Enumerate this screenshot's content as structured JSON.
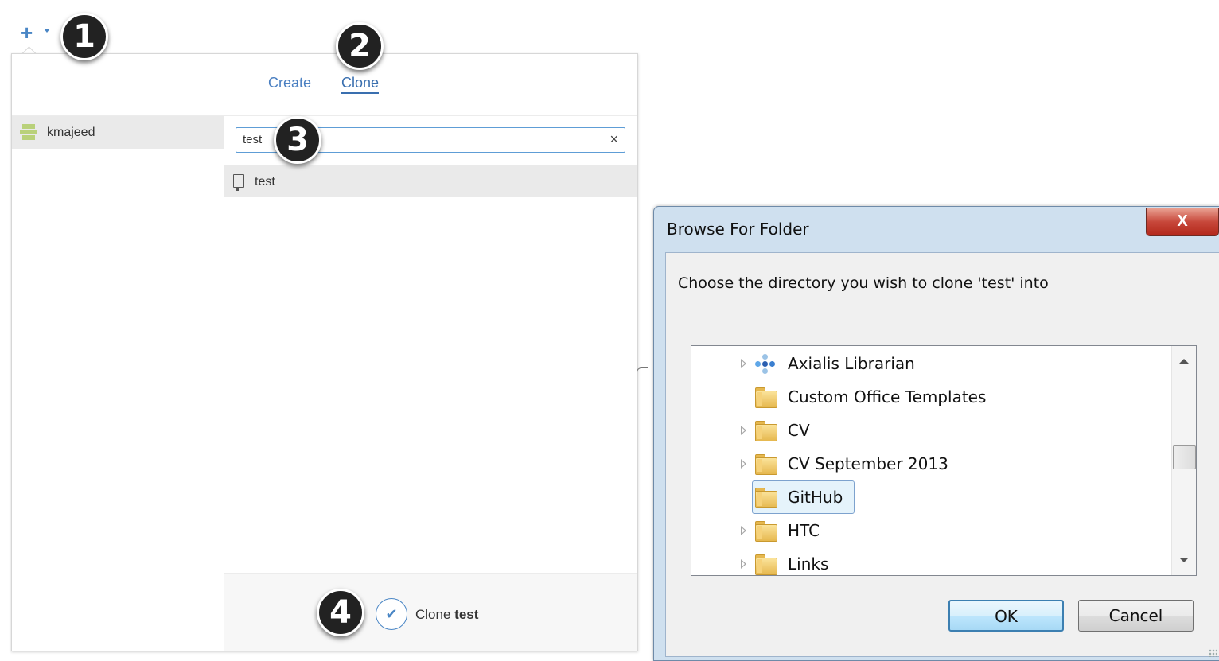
{
  "toolbar": {
    "add_symbol": "+"
  },
  "badges": [
    "1",
    "2",
    "3",
    "4"
  ],
  "tabs": [
    {
      "label": "Create",
      "active": false
    },
    {
      "label": "Clone",
      "active": true
    }
  ],
  "accounts": [
    {
      "name": "kmajeed",
      "selected": true
    }
  ],
  "filter": {
    "value": "test",
    "clear_symbol": "×"
  },
  "repos": [
    {
      "name": "test",
      "selected": true
    }
  ],
  "clone_button": {
    "prefix": "Clone",
    "repo": "test",
    "check_symbol": "✔"
  },
  "dialog": {
    "title": "Browse For Folder",
    "close_symbol": "X",
    "description": "Choose the directory you wish to clone 'test' into",
    "tree": [
      {
        "label": "Axialis Librarian",
        "expandable": true,
        "icon": "axialis-icon",
        "selected": false
      },
      {
        "label": "Custom Office Templates",
        "expandable": false,
        "icon": "folder-icon",
        "selected": false
      },
      {
        "label": "CV",
        "expandable": true,
        "icon": "folder-icon",
        "selected": false
      },
      {
        "label": "CV September 2013",
        "expandable": true,
        "icon": "folder-icon",
        "selected": false
      },
      {
        "label": "GitHub",
        "expandable": false,
        "icon": "folder-icon",
        "selected": true
      },
      {
        "label": "HTC",
        "expandable": true,
        "icon": "folder-icon",
        "selected": false
      },
      {
        "label": "Links",
        "expandable": true,
        "icon": "folder-icon",
        "selected": false
      }
    ],
    "ok_label": "OK",
    "cancel_label": "Cancel"
  },
  "colors": {
    "accent": "#4a86c5",
    "selected_row": "#eaeaea",
    "dialog_frame": "#cfe0ef",
    "close_red": "#c7473a",
    "folder_yellow": "#e6b84f"
  }
}
